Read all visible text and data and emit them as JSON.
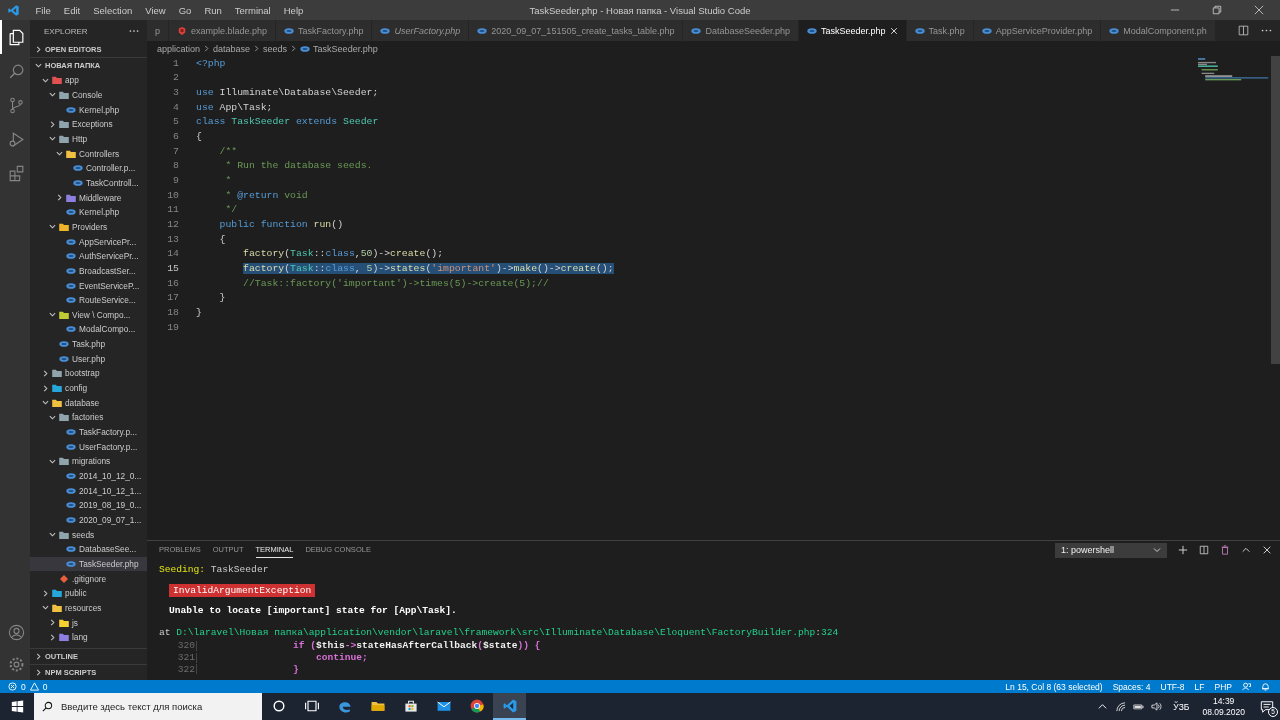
{
  "window": {
    "title": "TaskSeeder.php - Новая папка - Visual Studio Code"
  },
  "menu": [
    "File",
    "Edit",
    "Selection",
    "View",
    "Go",
    "Run",
    "Terminal",
    "Help"
  ],
  "activity_bar": [
    {
      "kind": "explorer",
      "selected": true
    },
    {
      "kind": "search",
      "selected": false
    },
    {
      "kind": "source-control",
      "selected": false
    },
    {
      "kind": "run",
      "selected": false
    },
    {
      "kind": "extensions",
      "selected": false
    }
  ],
  "activity_bar_bottom": [
    {
      "kind": "account"
    },
    {
      "kind": "settings"
    }
  ],
  "explorer": {
    "title": "EXPLORER",
    "open_editors": {
      "label": "OPEN EDITORS",
      "expanded": false
    },
    "folder": {
      "label": "НОВАЯ ПАПКА",
      "expanded": true,
      "tree": [
        {
          "kind": "folder",
          "label": "app",
          "color": "#e05252",
          "expanded": true,
          "selected": false,
          "children": [
            {
              "kind": "folder",
              "label": "Console",
              "color": "#90a4ae",
              "expanded": true,
              "selected": false,
              "children": [
                {
                  "kind": "php",
                  "label": "Kernel.php",
                  "selected": false
                }
              ]
            },
            {
              "kind": "folder",
              "label": "Exceptions",
              "color": "#90a4ae",
              "expanded": false,
              "selected": false
            },
            {
              "kind": "folder",
              "label": "Http",
              "color": "#90a4ae",
              "expanded": true,
              "selected": false,
              "children": [
                {
                  "kind": "folder",
                  "label": "Controllers",
                  "color": "#f0c040",
                  "expanded": true,
                  "selected": false,
                  "children": [
                    {
                      "kind": "php",
                      "label": "Controller.p...",
                      "selected": false
                    },
                    {
                      "kind": "php",
                      "label": "TaskControll...",
                      "selected": false
                    }
                  ]
                },
                {
                  "kind": "folder",
                  "label": "Middleware",
                  "color": "#8c7fe0",
                  "expanded": false,
                  "selected": false
                },
                {
                  "kind": "php",
                  "label": "Kernel.php",
                  "selected": false
                }
              ]
            },
            {
              "kind": "folder",
              "label": "Providers",
              "color": "#f0b429",
              "expanded": true,
              "selected": false,
              "children": [
                {
                  "kind": "php",
                  "label": "AppServicePr...",
                  "selected": false
                },
                {
                  "kind": "php",
                  "label": "AuthServicePr...",
                  "selected": false
                },
                {
                  "kind": "php",
                  "label": "BroadcastSer...",
                  "selected": false
                },
                {
                  "kind": "php",
                  "label": "EventServiceP...",
                  "selected": false
                },
                {
                  "kind": "php",
                  "label": "RouteService...",
                  "selected": false
                }
              ]
            },
            {
              "kind": "folder",
              "label": "View \\ Compo...",
              "color": "#c0ca33",
              "expanded": true,
              "selected": false,
              "children": [
                {
                  "kind": "php",
                  "label": "ModalCompo...",
                  "selected": false
                }
              ]
            },
            {
              "kind": "php",
              "label": "Task.php",
              "selected": false
            },
            {
              "kind": "php",
              "label": "User.php",
              "selected": false
            }
          ]
        },
        {
          "kind": "folder",
          "label": "bootstrap",
          "color": "#90a4ae",
          "expanded": false,
          "selected": false
        },
        {
          "kind": "folder",
          "label": "config",
          "color": "#26a6d9",
          "expanded": false,
          "selected": false
        },
        {
          "kind": "folder",
          "label": "database",
          "color": "#f0c040",
          "expanded": true,
          "selected": false,
          "children": [
            {
              "kind": "folder",
              "label": "factories",
              "color": "#90a4ae",
              "expanded": true,
              "selected": false,
              "children": [
                {
                  "kind": "php",
                  "label": "TaskFactory.p...",
                  "selected": false
                },
                {
                  "kind": "php",
                  "label": "UserFactory.p...",
                  "selected": false
                }
              ]
            },
            {
              "kind": "folder",
              "label": "migrations",
              "color": "#90a4ae",
              "expanded": true,
              "selected": false,
              "children": [
                {
                  "kind": "php",
                  "label": "2014_10_12_0...",
                  "selected": false
                },
                {
                  "kind": "php",
                  "label": "2014_10_12_1...",
                  "selected": false
                },
                {
                  "kind": "php",
                  "label": "2019_08_19_0...",
                  "selected": false
                },
                {
                  "kind": "php",
                  "label": "2020_09_07_1...",
                  "selected": false
                }
              ]
            },
            {
              "kind": "folder",
              "label": "seeds",
              "color": "#90a4ae",
              "expanded": true,
              "selected": false,
              "children": [
                {
                  "kind": "php",
                  "label": "DatabaseSee...",
                  "selected": false
                },
                {
                  "kind": "php",
                  "label": "TaskSeeder.php",
                  "selected": true
                }
              ]
            },
            {
              "kind": "git",
              "label": ".gitignore",
              "selected": false
            }
          ]
        },
        {
          "kind": "folder",
          "label": "public",
          "color": "#26a6d9",
          "expanded": false,
          "selected": false
        },
        {
          "kind": "folder",
          "label": "resources",
          "color": "#f0c040",
          "expanded": true,
          "selected": false,
          "children": [
            {
              "kind": "folder",
              "label": "js",
              "color": "#f5d033",
              "expanded": false,
              "selected": false
            },
            {
              "kind": "folder",
              "label": "lang",
              "color": "#8c7fe0",
              "expanded": false,
              "selected": false
            }
          ]
        }
      ]
    },
    "bottom_sections": [
      {
        "label": "OUTLINE",
        "expanded": false
      },
      {
        "label": "NPM SCRIPTS",
        "expanded": false
      }
    ]
  },
  "tabs": [
    {
      "label": "p",
      "kind": "partial",
      "selected": false,
      "preview": false
    },
    {
      "label": "example.blade.php",
      "kind": "blade",
      "selected": false,
      "preview": false
    },
    {
      "label": "TaskFactory.php",
      "kind": "php",
      "selected": false,
      "preview": false
    },
    {
      "label": "UserFactory.php",
      "kind": "php",
      "selected": false,
      "preview": true
    },
    {
      "label": "2020_09_07_151505_create_tasks_table.php",
      "kind": "php",
      "selected": false,
      "preview": false
    },
    {
      "label": "DatabaseSeeder.php",
      "kind": "php",
      "selected": false,
      "preview": false
    },
    {
      "label": "TaskSeeder.php",
      "kind": "php",
      "selected": true,
      "preview": false
    },
    {
      "label": "Task.php",
      "kind": "php",
      "selected": false,
      "preview": false
    },
    {
      "label": "AppServiceProvider.php",
      "kind": "php",
      "selected": false,
      "preview": false
    },
    {
      "label": "ModalComponent.ph",
      "kind": "php",
      "selected": false,
      "preview": false
    }
  ],
  "breadcrumbs": [
    "application",
    "database",
    "seeds",
    "TaskSeeder.php"
  ],
  "code": [
    {
      "number": "1",
      "selected": false,
      "tokens": [
        {
          "text": "<?php",
          "kind": "kw"
        }
      ]
    },
    {
      "number": "2",
      "selected": false
    },
    {
      "number": "3",
      "selected": false,
      "tokens": [
        {
          "text": "use",
          "kind": "kw"
        },
        {
          "text": " Illuminate\\Database\\Seeder;",
          "kind": "plain"
        }
      ]
    },
    {
      "number": "4",
      "selected": false,
      "tokens": [
        {
          "text": "use",
          "kind": "kw"
        },
        {
          "text": " App\\Task;",
          "kind": "plain"
        }
      ]
    },
    {
      "number": "5",
      "selected": false,
      "tokens": [
        {
          "text": "class",
          "kind": "kw"
        },
        {
          "text": " TaskSeeder ",
          "kind": "cls"
        },
        {
          "text": "extends",
          "kind": "kw"
        },
        {
          "text": " Seeder",
          "kind": "cls"
        }
      ]
    },
    {
      "number": "6",
      "selected": false,
      "tokens": [
        {
          "text": "{",
          "kind": "plain"
        }
      ]
    },
    {
      "number": "7",
      "selected": false,
      "tokens": [
        {
          "text": "    /**",
          "kind": "comment"
        }
      ]
    },
    {
      "number": "8",
      "selected": false,
      "tokens": [
        {
          "text": "     * Run the database seeds.",
          "kind": "comment"
        }
      ]
    },
    {
      "number": "9",
      "selected": false,
      "tokens": [
        {
          "text": "     *",
          "kind": "comment"
        }
      ]
    },
    {
      "number": "10",
      "selected": false,
      "tokens": [
        {
          "text": "     * ",
          "kind": "comment"
        },
        {
          "text": "@return",
          "kind": "kw"
        },
        {
          "text": " void",
          "kind": "comment"
        }
      ]
    },
    {
      "number": "11",
      "selected": false,
      "tokens": [
        {
          "text": "     */",
          "kind": "comment"
        }
      ]
    },
    {
      "number": "12",
      "selected": false,
      "tokens": [
        {
          "text": "    public function ",
          "kind": "kw"
        },
        {
          "text": "run",
          "kind": "fn"
        },
        {
          "text": "()",
          "kind": "plain"
        }
      ]
    },
    {
      "number": "13",
      "selected": false,
      "tokens": [
        {
          "text": "    {",
          "kind": "plain"
        }
      ]
    },
    {
      "number": "14",
      "selected": false,
      "tokens": [
        {
          "text": "        factory",
          "kind": "fn"
        },
        {
          "text": "(",
          "kind": "plain"
        },
        {
          "text": "Task",
          "kind": "cls"
        },
        {
          "text": "::",
          "kind": "plain"
        },
        {
          "text": "class",
          "kind": "kw"
        },
        {
          "text": ",",
          "kind": "plain"
        },
        {
          "text": "50",
          "kind": "num"
        },
        {
          "text": ")->",
          "kind": "plain"
        },
        {
          "text": "create",
          "kind": "fn"
        },
        {
          "text": "();",
          "kind": "plain"
        }
      ]
    },
    {
      "number": "15",
      "selected": true,
      "tokens": [
        {
          "text": "        factory",
          "kind": "fn"
        },
        {
          "text": "(",
          "kind": "plain"
        },
        {
          "text": "Task",
          "kind": "cls"
        },
        {
          "text": "::",
          "kind": "plain"
        },
        {
          "text": "class",
          "kind": "kw"
        },
        {
          "text": ", ",
          "kind": "plain"
        },
        {
          "text": "5",
          "kind": "num"
        },
        {
          "text": ")->",
          "kind": "plain"
        },
        {
          "text": "states",
          "kind": "fn"
        },
        {
          "text": "(",
          "kind": "plain"
        },
        {
          "text": "'important'",
          "kind": "str"
        },
        {
          "text": ")->",
          "kind": "plain"
        },
        {
          "text": "make",
          "kind": "fn"
        },
        {
          "text": "()->",
          "kind": "plain"
        },
        {
          "text": "create",
          "kind": "fn"
        },
        {
          "text": "();",
          "kind": "plain"
        }
      ]
    },
    {
      "number": "16",
      "selected": false,
      "tokens": [
        {
          "text": "        //Task::factory('important')->times(5)->create(5);//",
          "kind": "comment"
        }
      ]
    },
    {
      "number": "17",
      "selected": false,
      "tokens": [
        {
          "text": "    }",
          "kind": "plain"
        }
      ]
    },
    {
      "number": "18",
      "selected": false,
      "tokens": [
        {
          "text": "}",
          "kind": "plain"
        }
      ]
    },
    {
      "number": "19",
      "selected": false
    }
  ],
  "panel": {
    "tabs": [
      {
        "label": "PROBLEMS",
        "selected": false
      },
      {
        "label": "OUTPUT",
        "selected": false
      },
      {
        "label": "TERMINAL",
        "selected": true
      },
      {
        "label": "DEBUG CONSOLE",
        "selected": false
      }
    ],
    "terminal_picker": "1: powershell",
    "lines": [
      {
        "kind": "text",
        "parts": [
          {
            "text": "Seeding:",
            "kind": "yellow"
          },
          {
            "text": " TaskSeeder",
            "kind": "plain"
          }
        ]
      },
      {
        "kind": "badge",
        "text": "InvalidArgumentException"
      },
      {
        "kind": "message",
        "text": "Unable to locate [important] state for [App\\Task]."
      },
      {
        "kind": "text",
        "parts": [
          {
            "text": "at ",
            "kind": "plain"
          },
          {
            "text": "D:\\laravel\\Новая папка\\application\\vendor\\laravel\\framework\\src\\Illuminate\\Database\\Eloquent\\FactoryBuilder.php",
            "kind": "green"
          },
          {
            "text": ":",
            "kind": "plain"
          },
          {
            "text": "324",
            "kind": "green"
          }
        ]
      },
      {
        "kind": "source",
        "number": "320",
        "parts": [
          {
            "text": "if (",
            "kind": "magenta"
          },
          {
            "text": "$this",
            "kind": "white"
          },
          {
            "text": "->",
            "kind": "magenta"
          },
          {
            "text": "stateHasAfterCallback",
            "kind": "white"
          },
          {
            "text": "(",
            "kind": "magenta"
          },
          {
            "text": "$state",
            "kind": "white"
          },
          {
            "text": ")) {",
            "kind": "magenta"
          }
        ]
      },
      {
        "kind": "source",
        "number": "321",
        "parts": [
          {
            "text": "    continue;",
            "kind": "magenta"
          }
        ]
      },
      {
        "kind": "source",
        "number": "322",
        "parts": [
          {
            "text": "}",
            "kind": "magenta"
          }
        ]
      }
    ]
  },
  "status_bar": {
    "errors": "0",
    "warnings": "0",
    "items": [
      "Ln 15, Col 8 (63 selected)",
      "Spaces: 4",
      "UTF-8",
      "LF",
      "PHP"
    ]
  },
  "taskbar": {
    "search": {
      "placeholder": "Введите здесь текст для поиска"
    },
    "apps": [
      {
        "kind": "cortana",
        "active": false
      },
      {
        "kind": "task-view",
        "active": false
      },
      {
        "kind": "edge",
        "active": false
      },
      {
        "kind": "file-explorer",
        "active": false
      },
      {
        "kind": "store",
        "active": false
      },
      {
        "kind": "mail",
        "active": false
      },
      {
        "kind": "chrome",
        "active": false
      },
      {
        "kind": "vscode",
        "active": true
      }
    ],
    "tray": {
      "language": "ЎЗБ",
      "time": "14:39",
      "date": "08.09.2020",
      "notifications": "5"
    }
  }
}
